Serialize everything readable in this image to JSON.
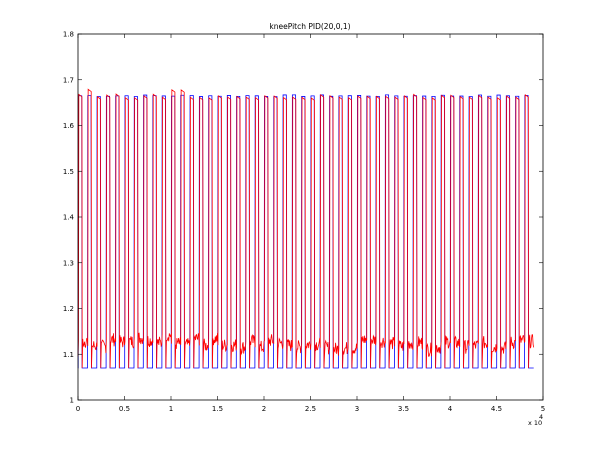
{
  "chart_data": {
    "type": "line",
    "title": "kneePitch PID(20,0,1)",
    "xlabel": "",
    "ylabel": "",
    "xlim": [
      0,
      50000
    ],
    "ylim": [
      1,
      1.8
    ],
    "x_exponent_label": "x 10",
    "x_exponent_power": "4",
    "x_ticks": [
      0,
      5000,
      10000,
      15000,
      20000,
      25000,
      30000,
      35000,
      40000,
      45000,
      50000
    ],
    "x_tick_labels": [
      "0",
      "0.5",
      "1",
      "1.5",
      "2",
      "2.5",
      "3",
      "3.5",
      "4",
      "4.5",
      "5"
    ],
    "y_ticks": [
      1,
      1.1,
      1.2,
      1.3,
      1.4,
      1.5,
      1.6,
      1.7,
      1.8
    ],
    "y_tick_labels": [
      "1",
      "1.1",
      "1.2",
      "1.3",
      "1.4",
      "1.5",
      "1.6",
      "1.7",
      "1.8"
    ],
    "grid": false,
    "legend": "none",
    "series": [
      {
        "color": "#0000ff",
        "pattern": "square-wave",
        "cycles": 49,
        "x_range": [
          0,
          49000
        ],
        "low": 1.07,
        "high": 1.665
      },
      {
        "color": "#ff0000",
        "pattern": "square-wave",
        "cycles": 49,
        "x_range": [
          0,
          49000
        ],
        "low_range": [
          1.09,
          1.15
        ],
        "high_range": [
          1.66,
          1.68
        ]
      }
    ]
  }
}
